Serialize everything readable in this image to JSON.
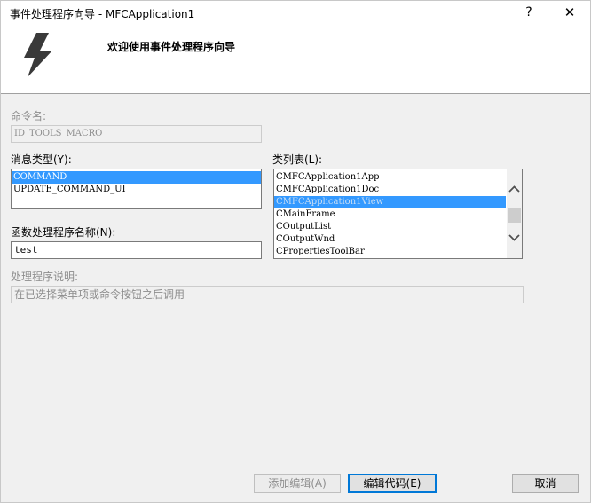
{
  "window": {
    "title": "事件处理程序向导 - MFCApplication1",
    "help_label": "?",
    "close_label": "✕"
  },
  "header": {
    "title": "欢迎使用事件处理程序向导",
    "icon": "lightning-bolt-icon"
  },
  "command_name": {
    "label": "命令名:",
    "value": "ID_TOOLS_MACRO"
  },
  "message_type": {
    "label": "消息类型(Y):",
    "items": [
      "COMMAND",
      "UPDATE_COMMAND_UI"
    ],
    "selected": "COMMAND"
  },
  "class_list": {
    "label": "类列表(L):",
    "items": [
      "CMFCApplication1App",
      "CMFCApplication1Doc",
      "CMFCApplication1View",
      "CMainFrame",
      "COutputList",
      "COutputWnd",
      "CPropertiesToolBar"
    ],
    "selected": "CMFCApplication1View"
  },
  "function_name": {
    "label": "函数处理程序名称(N):",
    "value": "test"
  },
  "description": {
    "label": "处理程序说明:",
    "value": "在已选择菜单项或命令按钮之后调用"
  },
  "buttons": {
    "add_edit": "添加编辑(A)",
    "edit_code": "编辑代码(E)",
    "cancel": "取消"
  },
  "colors": {
    "selection": "#3399ff",
    "default_button_border": "#0078d7"
  }
}
